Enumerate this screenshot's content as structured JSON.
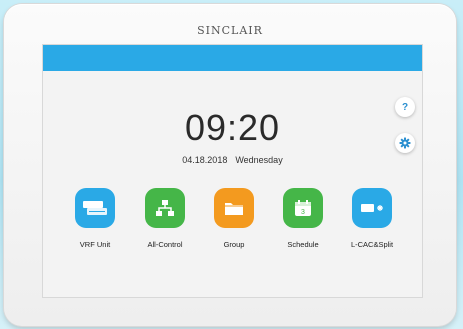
{
  "brand": "SINCLAIR",
  "clock": {
    "time": "09:20",
    "date": "04.18.2018",
    "weekday": "Wednesday"
  },
  "side": {
    "help_label": "?"
  },
  "tiles": [
    {
      "label": "VRF Unit",
      "color": "#2aa9e6",
      "icon": "vrf-unit-icon"
    },
    {
      "label": "All-Control",
      "color": "#45b648",
      "icon": "all-control-icon"
    },
    {
      "label": "Group",
      "color": "#f39a1f",
      "icon": "group-folder-icon"
    },
    {
      "label": "Schedule",
      "color": "#45b648",
      "icon": "schedule-calendar-icon"
    },
    {
      "label": "L-CAC&Split",
      "color": "#2aa9e6",
      "icon": "lcac-split-icon"
    }
  ],
  "colors": {
    "topbar": "#2aa9e6"
  }
}
